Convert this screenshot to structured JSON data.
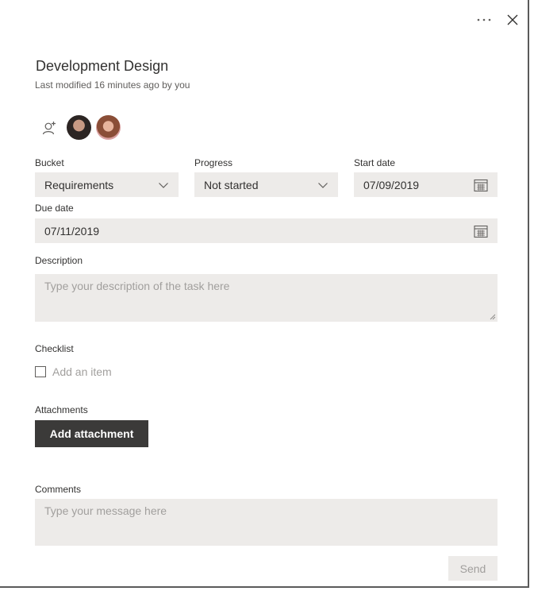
{
  "header": {
    "more_icon": "ellipsis-icon",
    "close_icon": "close-icon",
    "title": "Development Design",
    "subtitle": "Last modified 16 minutes ago by you"
  },
  "members": {
    "add_icon": "add-person-icon",
    "avatars": [
      "avatar",
      "avatar"
    ]
  },
  "fields": {
    "bucket": {
      "label": "Bucket",
      "value": "Requirements"
    },
    "progress": {
      "label": "Progress",
      "value": "Not started"
    },
    "start_date": {
      "label": "Start date",
      "value": "07/09/2019"
    },
    "due_date": {
      "label": "Due date",
      "value": "07/11/2019"
    }
  },
  "description": {
    "label": "Description",
    "placeholder": "Type your description of the task here"
  },
  "checklist": {
    "label": "Checklist",
    "placeholder": "Add an item"
  },
  "attachments": {
    "label": "Attachments",
    "button": "Add attachment"
  },
  "comments": {
    "label": "Comments",
    "placeholder": "Type your message here",
    "send": "Send"
  },
  "colors": {
    "field_bg": "#edebe9",
    "primary_button": "#3b3a39",
    "placeholder": "#a19f9d"
  }
}
